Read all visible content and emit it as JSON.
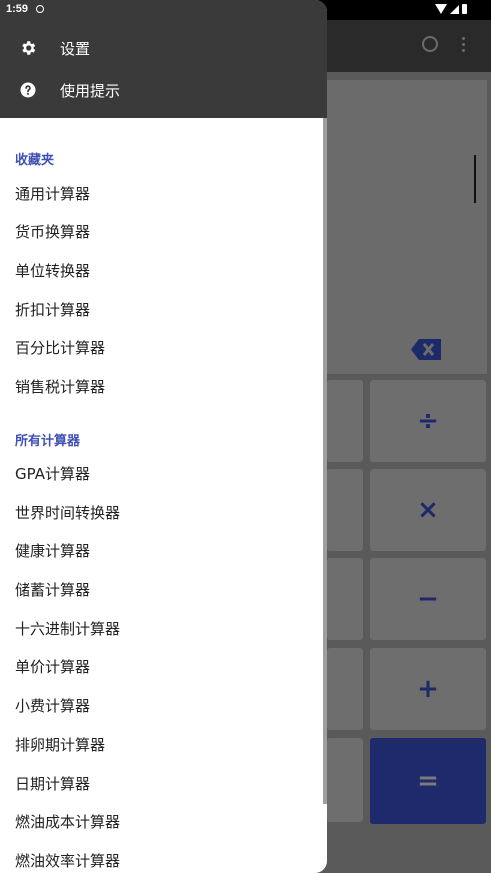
{
  "status_bar": {
    "time": "1:59"
  },
  "app": {
    "keys": {
      "divide": "÷",
      "multiply": "×",
      "minus": "−",
      "plus": "+",
      "equals": "="
    }
  },
  "drawer": {
    "header_items": [
      {
        "label": "设置",
        "icon": "gear-icon"
      },
      {
        "label": "使用提示",
        "icon": "help-icon"
      }
    ],
    "favorites_title": "收藏夹",
    "favorites": [
      "通用计算器",
      "货币换算器",
      "单位转换器",
      "折扣计算器",
      "百分比计算器",
      "销售税计算器"
    ],
    "all_title": "所有计算器",
    "all": [
      "GPA计算器",
      "世界时间转换器",
      "健康计算器",
      "储蓄计算器",
      "十六进制计算器",
      "单价计算器",
      "小费计算器",
      "排卵期计算器",
      "日期计算器",
      "燃油成本计算器",
      "燃油效率计算器"
    ]
  },
  "colors": {
    "accent": "#3f51b5",
    "equals_key": "#1f2a6d"
  }
}
